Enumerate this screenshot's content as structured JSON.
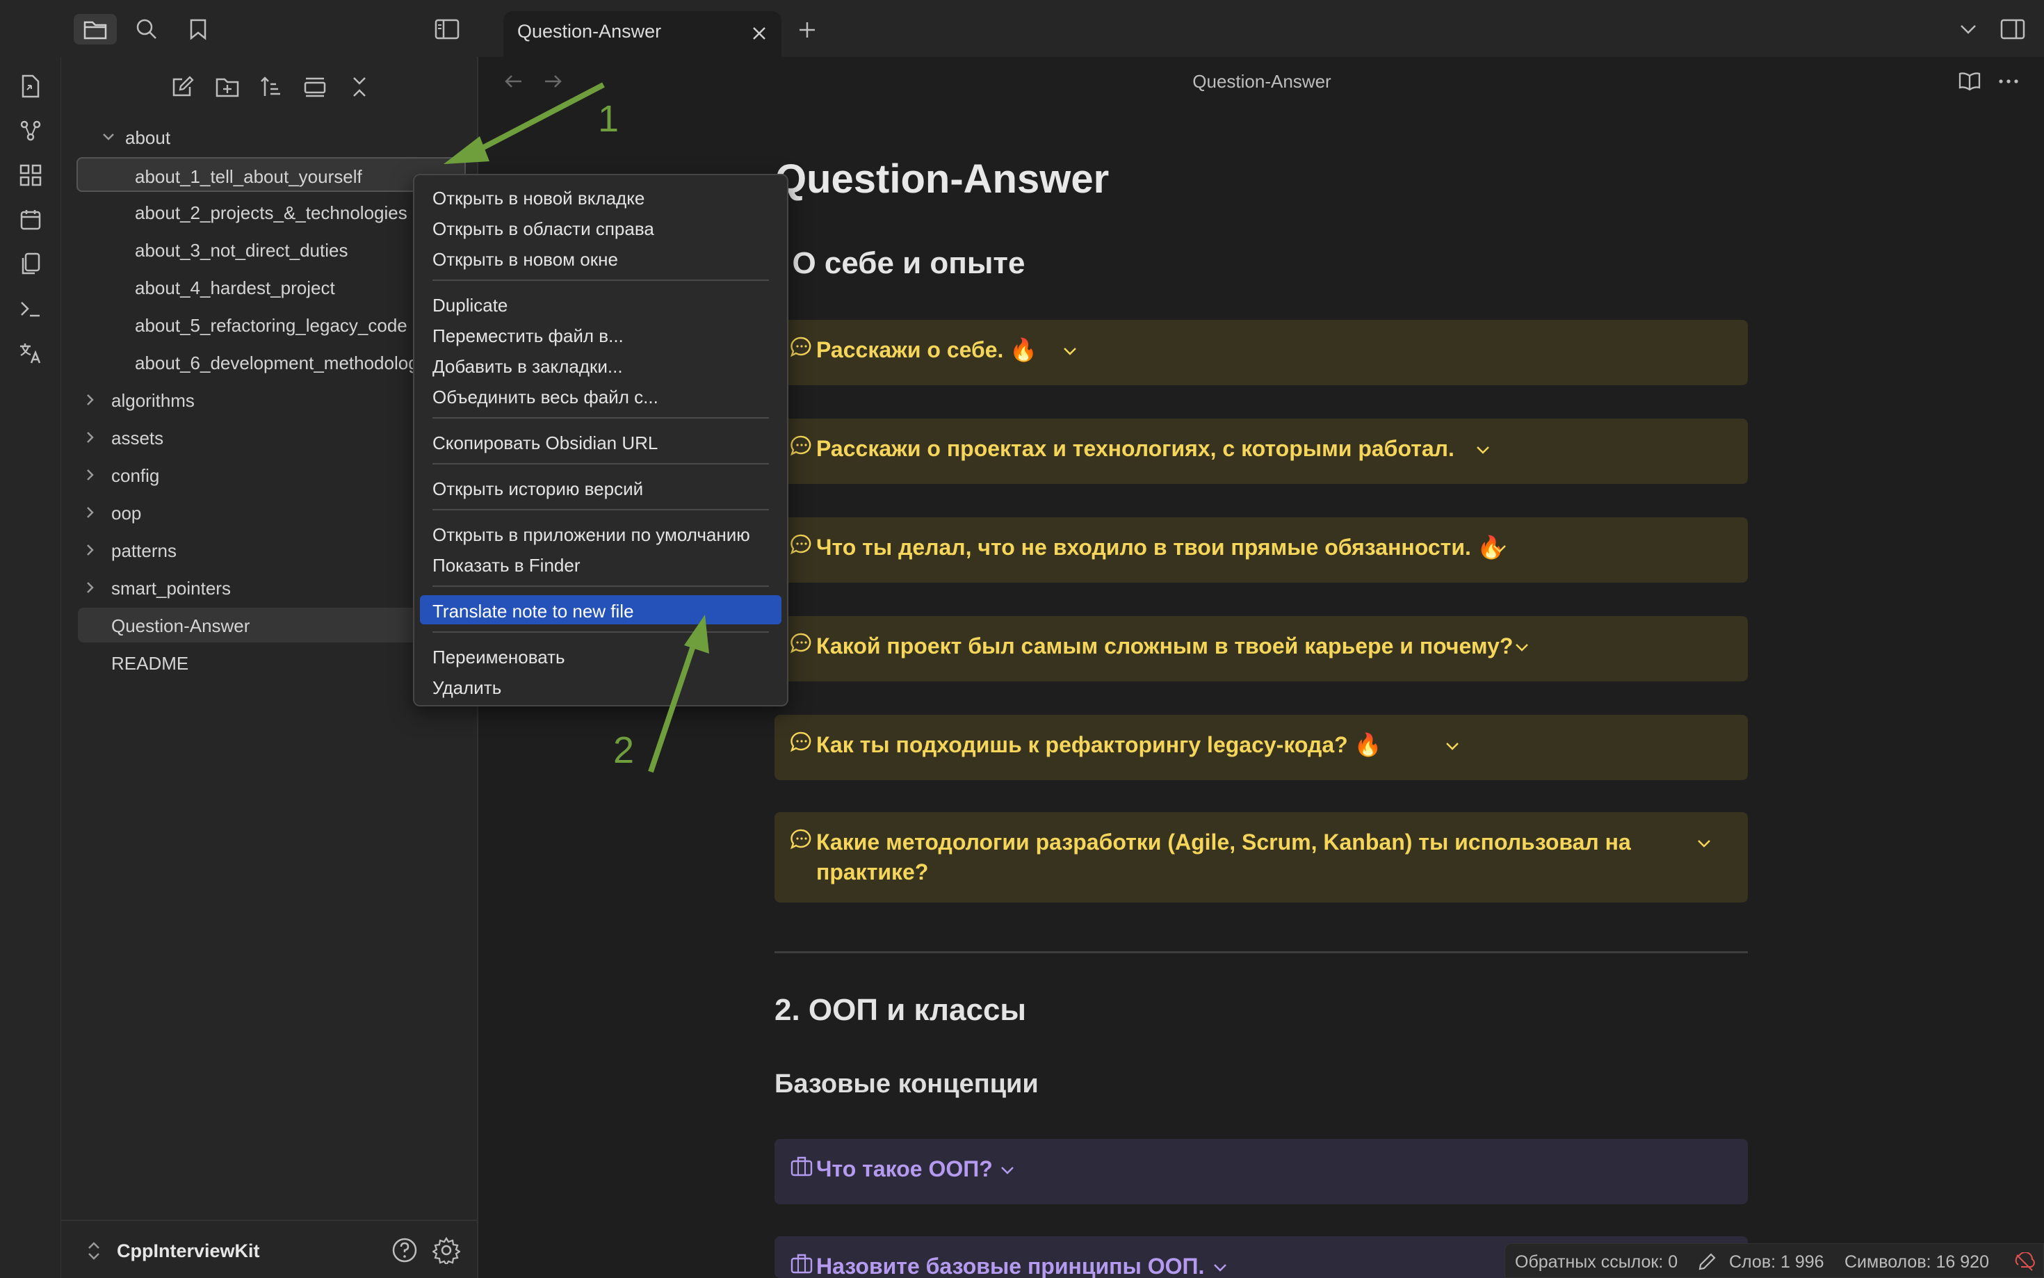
{
  "tab": {
    "title": "Question-Answer"
  },
  "sidebar": {
    "items": [
      {
        "label": "about",
        "expanded": true,
        "indent": 0
      },
      {
        "label": "about_1_tell_about_yourself",
        "indent": 1,
        "selected": true
      },
      {
        "label": "about_2_projects_&_technologies",
        "indent": 1
      },
      {
        "label": "about_3_not_direct_duties",
        "indent": 1
      },
      {
        "label": "about_4_hardest_project",
        "indent": 1
      },
      {
        "label": "about_5_refactoring_legacy_code",
        "indent": 1
      },
      {
        "label": "about_6_development_methodologies",
        "indent": 1
      },
      {
        "label": "algorithms",
        "folder": true
      },
      {
        "label": "assets",
        "folder": true
      },
      {
        "label": "config",
        "folder": true
      },
      {
        "label": "oop",
        "folder": true
      },
      {
        "label": "patterns",
        "folder": true
      },
      {
        "label": "smart_pointers",
        "folder": true
      },
      {
        "label": "Question-Answer",
        "current": true
      },
      {
        "label": "README"
      }
    ],
    "vault_name": "CppInterviewKit"
  },
  "main": {
    "view_title": "Question-Answer",
    "h1": "Question-Answer",
    "section1": ". О себе и опыте",
    "callouts": [
      "Расскажи о себе. 🔥",
      "Расскажи о проектах и технологиях, с которыми работал.",
      "Что ты делал, что не входило в твои прямые обязанности. 🔥",
      "Какой проект был самым сложным в твоей карьере и почему?",
      "Как ты подходишь к рефакторингу legacy-кода? 🔥",
      "Какие методологии разработки (Agile, Scrum, Kanban) ты использовал на практике?"
    ],
    "section2": "2. ООП и классы",
    "subsection": "Базовые концепции",
    "callouts2": [
      "Что такое ООП?",
      "Назовите базовые принципы ООП."
    ]
  },
  "context_menu": {
    "items": [
      {
        "label": "Открыть в новой вкладке"
      },
      {
        "label": "Открыть в области справа"
      },
      {
        "label": "Открыть в новом окне"
      },
      {
        "label": "Duplicate"
      },
      {
        "label": "Переместить файл в..."
      },
      {
        "label": "Добавить в закладки..."
      },
      {
        "label": "Объединить весь файл с..."
      },
      {
        "label": "Скопировать Obsidian URL"
      },
      {
        "label": "Открыть историю версий"
      },
      {
        "label": "Открыть в приложении по умолчанию"
      },
      {
        "label": "Показать в Finder"
      },
      {
        "label": "Translate note to new file",
        "highlighted": true
      },
      {
        "label": "Переименовать"
      },
      {
        "label": "Удалить"
      }
    ]
  },
  "statusbar": {
    "backlinks": "Обратных ссылок: 0",
    "words": "Слов: 1 996",
    "chars": "Символов: 16 920"
  },
  "annotations": {
    "arrow1_label": "1",
    "arrow2_label": "2"
  },
  "colors": {
    "accent": "#2452b8",
    "callout_yellow_text": "#f5d65a",
    "callout_purple_text": "#b59bf0",
    "annotation_green": "#6f9e3d"
  }
}
